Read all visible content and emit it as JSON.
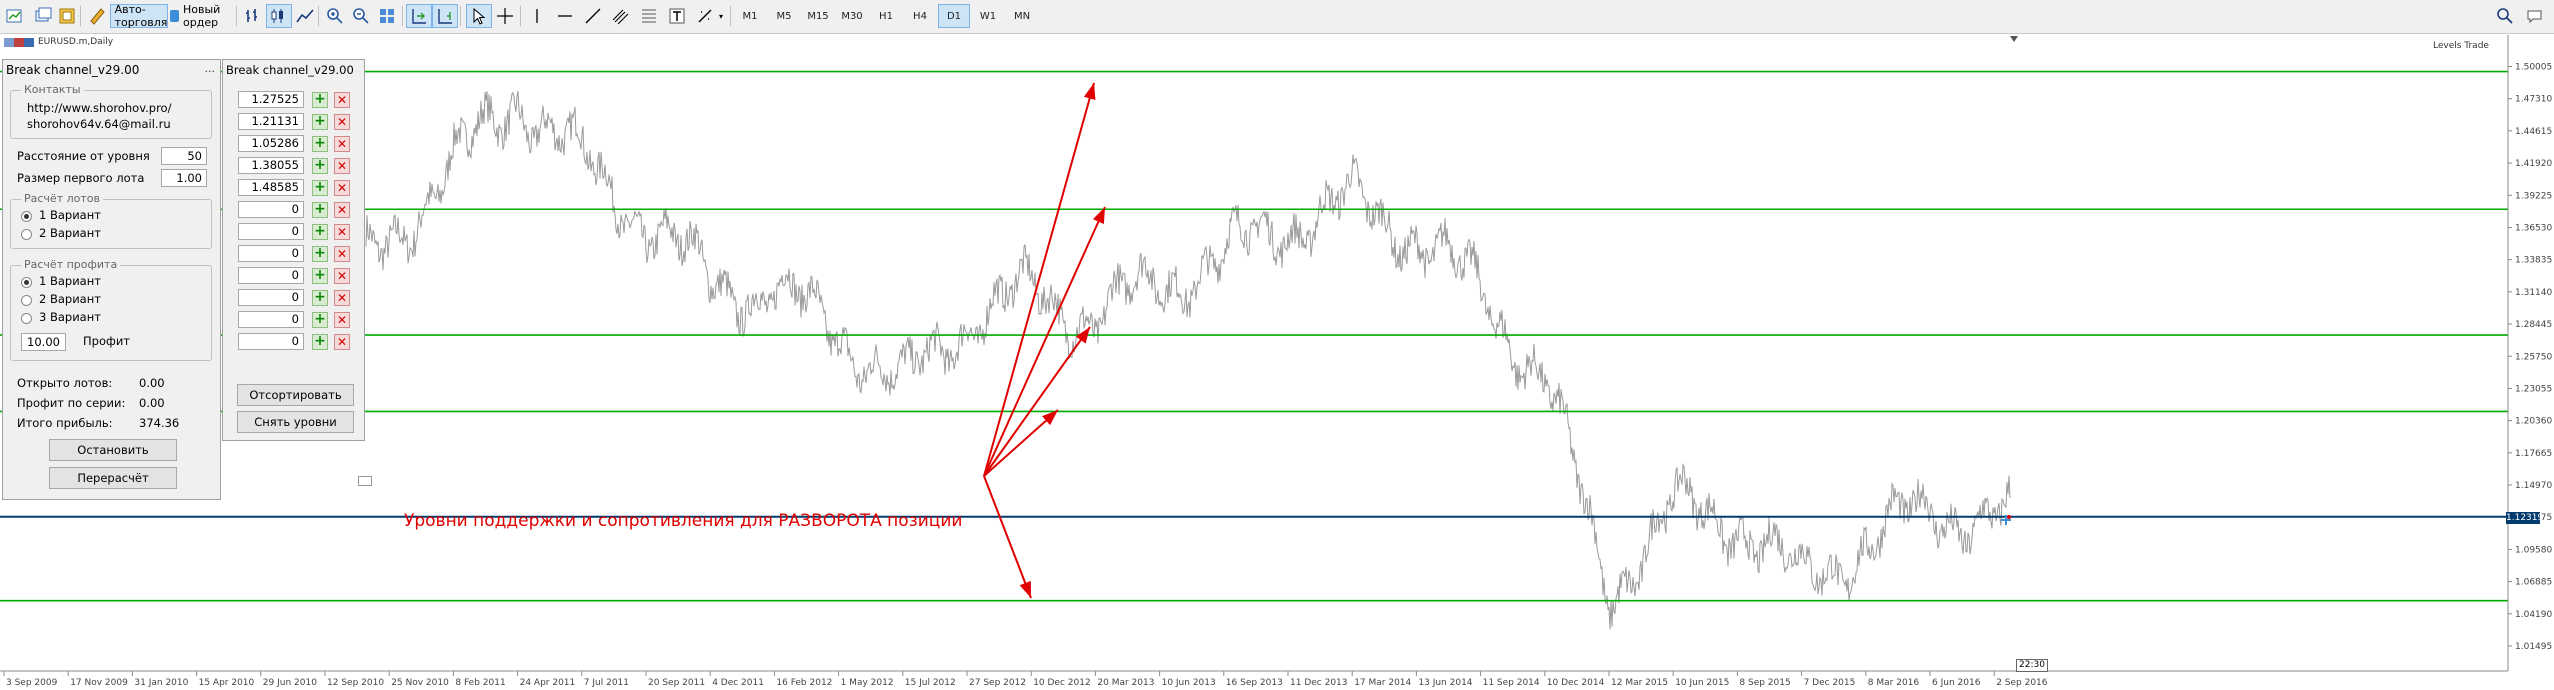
{
  "toolbar": {
    "auto_trading_label": "Авто-торговля",
    "new_order_label": "Новый ордер",
    "timeframes": [
      "M1",
      "M5",
      "M15",
      "M30",
      "H1",
      "H4",
      "D1",
      "W1",
      "MN"
    ],
    "active_timeframe": "D1"
  },
  "chart": {
    "symbol_label": "EURUSD.m,Daily",
    "indicator_label": "Levels Trade",
    "current_price": "1.12319",
    "time_marker": "22:30",
    "annotation": "Уровни поддержки и сопротивления для РАЗВОРОТА позиции",
    "colors": {
      "level": "#00aa00",
      "price_series": "#9a9a9a",
      "arrows": "#e00000",
      "current_line": "#003a6e"
    }
  },
  "chart_data": {
    "type": "line",
    "title": "",
    "y_ticks": [
      "1.50005",
      "1.47310",
      "1.44615",
      "1.41920",
      "1.39225",
      "1.36530",
      "1.33835",
      "1.31140",
      "1.28445",
      "1.25750",
      "1.23055",
      "1.20360",
      "1.17665",
      "1.14970",
      "1.12275",
      "1.09580",
      "1.06885",
      "1.04190",
      "1.01495"
    ],
    "x_ticks": [
      "3 Sep 2009",
      "17 Nov 2009",
      "31 Jan 2010",
      "15 Apr 2010",
      "29 Jun 2010",
      "12 Sep 2010",
      "25 Nov 2010",
      "8 Feb 2011",
      "24 Apr 2011",
      "7 Jul 2011",
      "20 Sep 2011",
      "4 Dec 2011",
      "16 Feb 2012",
      "1 May 2012",
      "15 Jul 2012",
      "27 Sep 2012",
      "10 Dec 2012",
      "20 Mar 2013",
      "10 Jun 2013",
      "16 Sep 2013",
      "11 Dec 2013",
      "17 Mar 2014",
      "13 Jun 2014",
      "11 Sep 2014",
      "10 Dec 2014",
      "12 Mar 2015",
      "10 Jun 2015",
      "8 Sep 2015",
      "7 Dec 2015",
      "8 Mar 2016",
      "6 Jun 2016",
      "2 Sep 2016"
    ],
    "levels": [
      1.4958,
      1.38055,
      1.27525,
      1.21131,
      1.12319,
      1.05286
    ],
    "series": [
      {
        "x": [
          "24 Apr 2011",
          "7 Jul 2011",
          "20 Sep 2011",
          "4 Dec 2011",
          "16 Feb 2012",
          "1 May 2012",
          "15 Jul 2012",
          "27 Sep 2012",
          "10 Dec 2012",
          "20 Mar 2013",
          "10 Jun 2013",
          "16 Sep 2013",
          "11 Dec 2013",
          "17 Mar 2014",
          "13 Jun 2014",
          "11 Sep 2014",
          "10 Dec 2014",
          "12 Mar 2015",
          "10 Jun 2015",
          "8 Sep 2015",
          "7 Dec 2015",
          "8 Mar 2016",
          "6 Jun 2016",
          "2 Sep 2016"
        ],
        "y": [
          1.475,
          1.42,
          1.37,
          1.32,
          1.31,
          1.28,
          1.23,
          1.29,
          1.31,
          1.29,
          1.32,
          1.34,
          1.37,
          1.385,
          1.36,
          1.31,
          1.24,
          1.06,
          1.13,
          1.12,
          1.07,
          1.1,
          1.13,
          1.12
        ]
      }
    ]
  },
  "panel1": {
    "title": "Break channel_v29.00",
    "minimize": "...",
    "contacts_title": "Контакты",
    "contact_url": "http://www.shorohov.pro/",
    "contact_email": "shorohov64v.64@mail.ru",
    "distance_label": "Расстояние от уровня",
    "distance_value": "50",
    "first_lot_label": "Размер первого лота",
    "first_lot_value": "1.00",
    "lot_calc_title": "Расчёт лотов",
    "lot_options": [
      "1 Вариант",
      "2 Вариант"
    ],
    "lot_selected": 0,
    "profit_calc_title": "Расчёт профита",
    "profit_options": [
      "1 Вариант",
      "2 Вариант",
      "3 Вариант"
    ],
    "profit_selected": 0,
    "profit_value": "10.00",
    "profit_label": "Профит",
    "open_lots_label": "Открыто лотов:",
    "open_lots_value": "0.00",
    "series_profit_label": "Профит по серии:",
    "series_profit_value": "0.00",
    "total_profit_label": "Итого прибыль:",
    "total_profit_value": "374.36",
    "stop_button": "Остановить",
    "recalc_button": "Перерасчёт"
  },
  "panel2": {
    "title": "Break channel_v29.00",
    "levels": [
      "1.27525",
      "1.21131",
      "1.05286",
      "1.38055",
      "1.48585",
      "0",
      "0",
      "0",
      "0",
      "0",
      "0",
      "0"
    ],
    "sort_button": "Отсортировать",
    "remove_button": "Снять уровни"
  }
}
